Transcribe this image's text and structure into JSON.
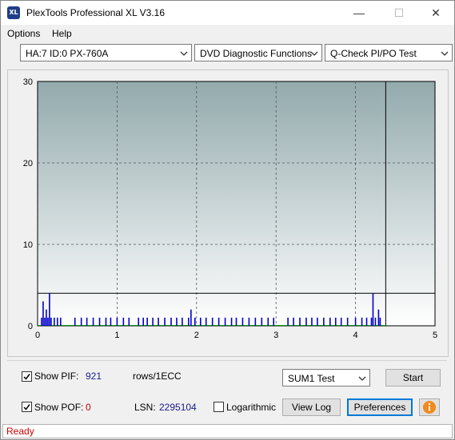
{
  "app": {
    "title": "PlexTools Professional XL V3.16",
    "icon_text": "XL"
  },
  "window_controls": {
    "minimize": "—",
    "maximize": "☐",
    "close": "✕"
  },
  "menu": [
    {
      "label": "Options",
      "mnemonic": "O"
    },
    {
      "label": "Help",
      "mnemonic": "H"
    }
  ],
  "toolbar": {
    "drive": "HA:7 ID:0  PX-760A",
    "function": "DVD Diagnostic Functions",
    "test": "Q-Check PI/PO Test"
  },
  "chart_data": {
    "type": "bar",
    "xlim": [
      0,
      5
    ],
    "ylim": [
      0,
      30
    ],
    "x_ticks": [
      "0",
      "1",
      "2",
      "3",
      "4",
      "5"
    ],
    "y_ticks": [
      "0",
      "10",
      "20",
      "30"
    ],
    "grid": true,
    "threshold_line": 4,
    "end_marker_x": 4.38,
    "series": [
      {
        "color": "#0000cc",
        "points": [
          [
            0.05,
            1
          ],
          [
            0.07,
            3
          ],
          [
            0.09,
            1
          ],
          [
            0.11,
            2
          ],
          [
            0.13,
            1
          ],
          [
            0.15,
            4
          ],
          [
            0.17,
            1
          ],
          [
            0.21,
            1
          ],
          [
            0.25,
            1
          ],
          [
            0.29,
            1
          ],
          [
            0.47,
            1
          ],
          [
            0.55,
            1
          ],
          [
            0.62,
            1
          ],
          [
            0.7,
            1
          ],
          [
            0.78,
            1
          ],
          [
            0.86,
            1
          ],
          [
            0.92,
            1
          ],
          [
            1.0,
            1
          ],
          [
            1.08,
            1
          ],
          [
            1.15,
            1
          ],
          [
            1.27,
            1
          ],
          [
            1.33,
            1
          ],
          [
            1.38,
            1
          ],
          [
            1.45,
            1
          ],
          [
            1.52,
            1
          ],
          [
            1.6,
            1
          ],
          [
            1.68,
            1
          ],
          [
            1.75,
            1
          ],
          [
            1.82,
            1
          ],
          [
            1.9,
            1
          ],
          [
            1.93,
            2
          ],
          [
            1.98,
            1
          ],
          [
            2.05,
            1
          ],
          [
            2.12,
            1
          ],
          [
            2.2,
            1
          ],
          [
            2.28,
            1
          ],
          [
            2.36,
            1
          ],
          [
            2.44,
            1
          ],
          [
            2.5,
            1
          ],
          [
            2.58,
            1
          ],
          [
            2.66,
            1
          ],
          [
            2.74,
            1
          ],
          [
            2.82,
            1
          ],
          [
            2.9,
            1
          ],
          [
            2.97,
            1
          ],
          [
            3.15,
            1
          ],
          [
            3.22,
            1
          ],
          [
            3.3,
            1
          ],
          [
            3.38,
            1
          ],
          [
            3.45,
            1
          ],
          [
            3.52,
            1
          ],
          [
            3.6,
            1
          ],
          [
            3.68,
            1
          ],
          [
            3.75,
            1
          ],
          [
            3.82,
            1
          ],
          [
            3.9,
            1
          ],
          [
            4.0,
            1
          ],
          [
            4.08,
            1
          ],
          [
            4.14,
            1
          ],
          [
            4.2,
            1
          ],
          [
            4.22,
            4
          ],
          [
            4.25,
            1
          ],
          [
            4.29,
            2
          ],
          [
            4.31,
            1
          ]
        ]
      }
    ]
  },
  "controls": {
    "show_pif_label": "Show PIF:",
    "show_pif_checked": true,
    "pif_value": "921",
    "pif_units": "rows/1ECC",
    "show_pof_label": "Show POF:",
    "show_pof_checked": true,
    "pof_value": "0",
    "lsn_label": "LSN:",
    "lsn_value": "2295104",
    "logarithmic_label": "Logarithmic",
    "logarithmic_checked": false,
    "sum_select": "SUM1 Test",
    "start_label": "Start",
    "viewlog_label": "View Log",
    "preferences_label": "Preferences",
    "info_icon": "info-icon"
  },
  "status": {
    "text": "Ready",
    "color": "#d00000"
  }
}
